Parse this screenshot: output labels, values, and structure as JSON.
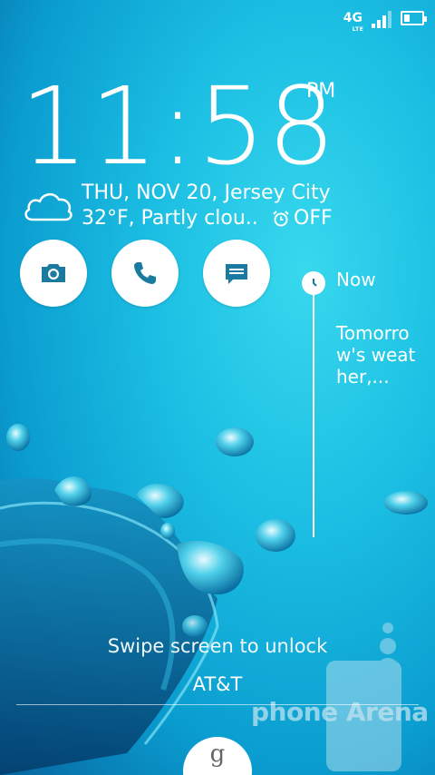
{
  "status_bar": {
    "network": "4G",
    "network_sub": "LTE",
    "signal_level": 4,
    "battery_level": 0.25
  },
  "clock": {
    "time": "11:58",
    "ampm": "PM"
  },
  "weather": {
    "date_location": "THU, NOV 20, Jersey City",
    "conditions": "32°F, Partly clou..",
    "alarm": "OFF",
    "icon": "cloud-icon"
  },
  "quick_launch": [
    {
      "name": "camera",
      "icon": "camera-icon"
    },
    {
      "name": "phone",
      "icon": "phone-icon"
    },
    {
      "name": "messages",
      "icon": "message-icon"
    }
  ],
  "timeline": {
    "now_label": "Now",
    "entry_text": "Tomorrow's weather,..."
  },
  "lock": {
    "hint": "Swipe screen to unlock",
    "carrier": "AT&T",
    "google_glyph": "g"
  },
  "watermark": "phone Arena",
  "colors": {
    "accent": "#1a7aa0",
    "background_top": "#1cbfe3",
    "background_bottom": "#06639c"
  }
}
